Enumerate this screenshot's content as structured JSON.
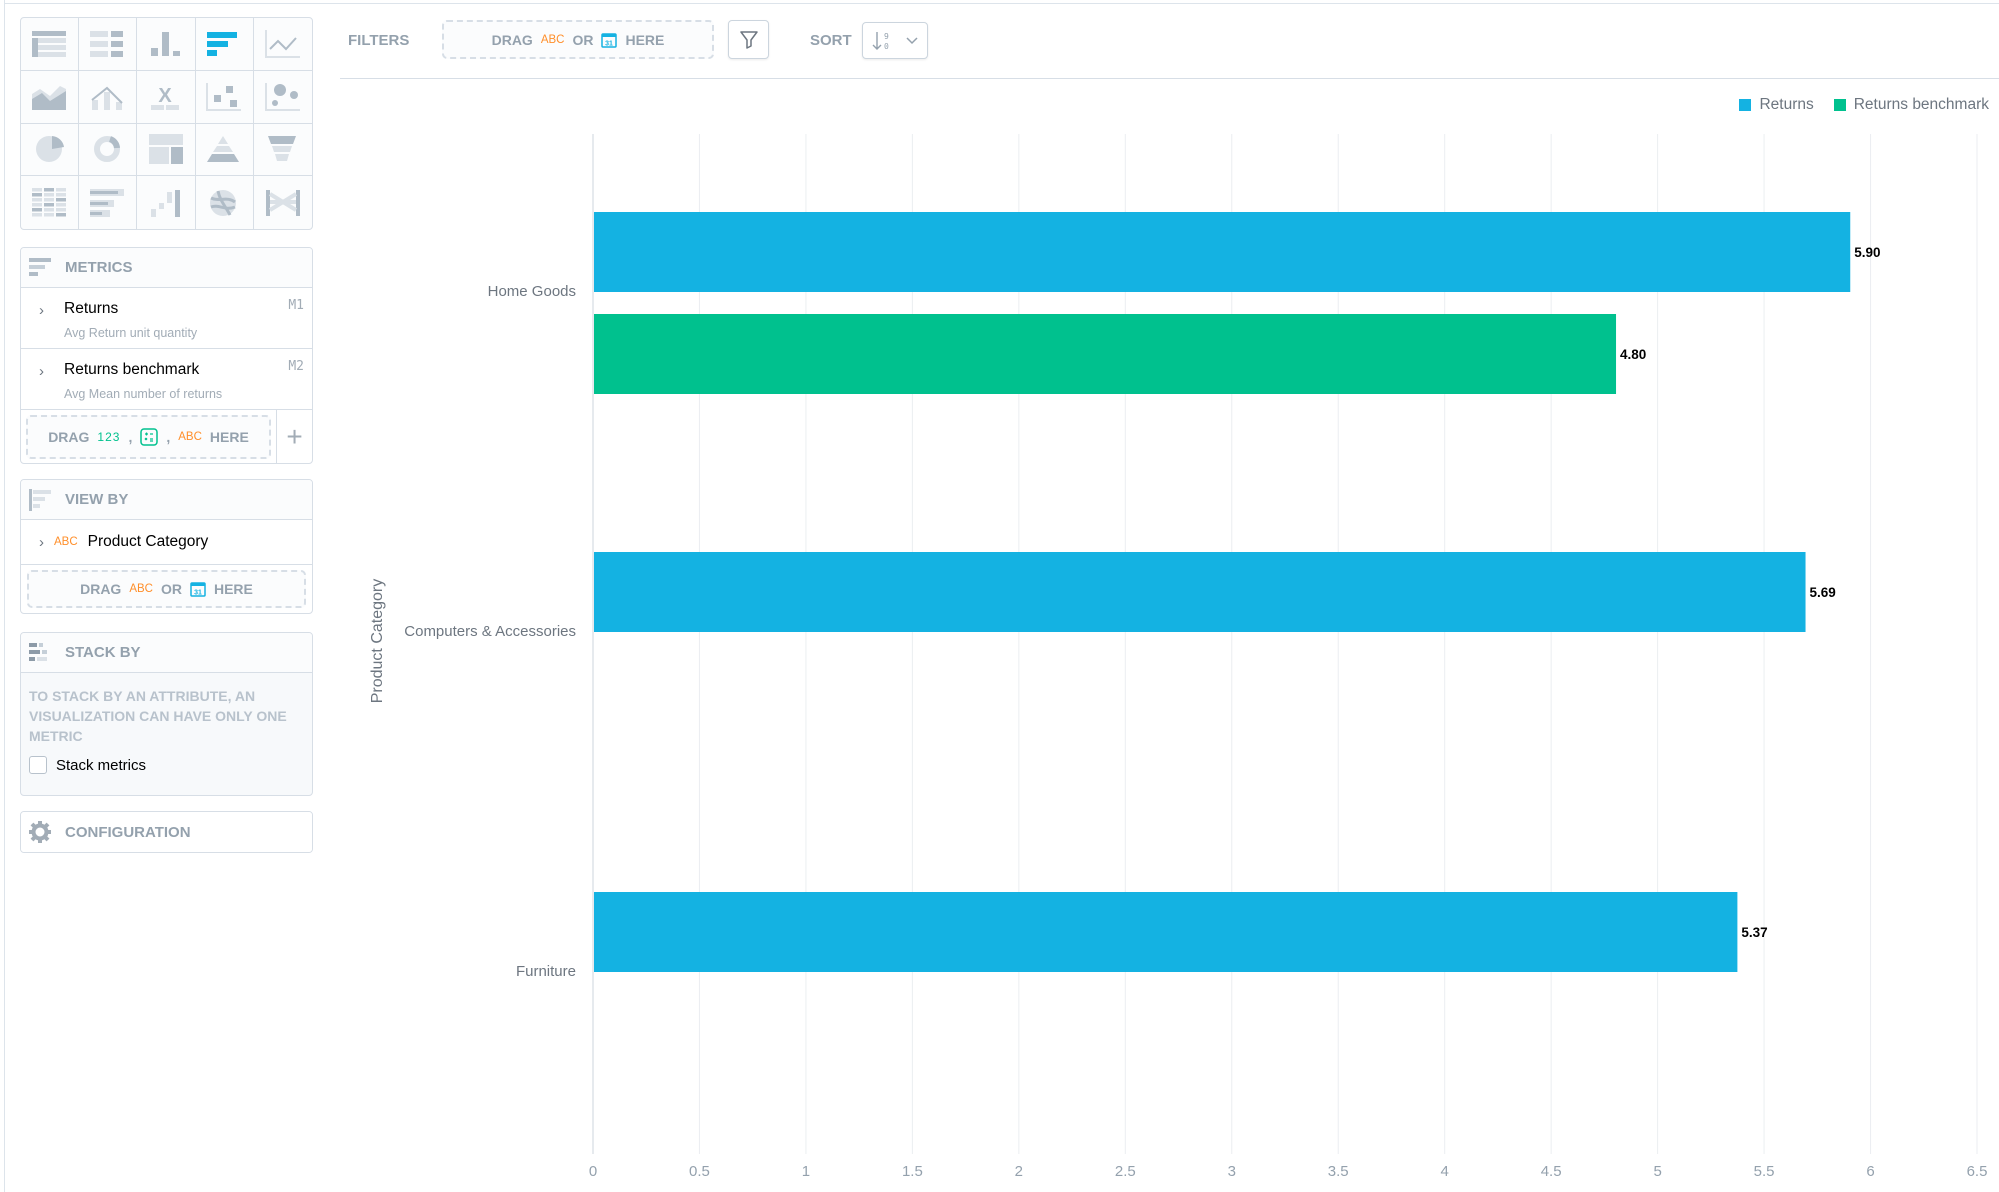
{
  "viz_types": [
    "table",
    "headline",
    "column-chart",
    "bar-chart",
    "line-chart",
    "area-chart",
    "combo-chart",
    "xirr",
    "scatter-plot",
    "bubble-chart",
    "pie-chart",
    "donut-chart",
    "treemap",
    "pyramid-chart",
    "funnel-chart",
    "heatmap",
    "bullet-chart",
    "waterfall-chart",
    "dependency-wheel",
    "sankey-chart"
  ],
  "active_viz": "bar-chart",
  "header": {
    "filters_label": "FILTERS",
    "filters_drop": {
      "drag": "DRAG",
      "abc": "ABC",
      "or": "OR",
      "here": "HERE"
    },
    "sort_label": "SORT"
  },
  "metrics": {
    "title": "METRICS",
    "items": [
      {
        "name": "Returns",
        "sub": "Avg Return unit quantity",
        "id": "M1"
      },
      {
        "name": "Returns benchmark",
        "sub": "Avg Mean number of returns",
        "id": "M2"
      }
    ],
    "drop": {
      "drag": "DRAG",
      "num": "123",
      "comma": ",",
      "abc": "ABC",
      "here": "HERE"
    }
  },
  "view_by": {
    "title": "VIEW BY",
    "item": {
      "abc": "ABC",
      "name": "Product Category"
    },
    "drop": {
      "drag": "DRAG",
      "abc": "ABC",
      "or": "OR",
      "here": "HERE"
    }
  },
  "stack_by": {
    "title": "STACK BY",
    "notice": "TO STACK BY AN ATTRIBUTE, AN VISUALIZATION CAN HAVE ONLY ONE METRIC",
    "checkbox_label": "Stack metrics",
    "checked": false
  },
  "configuration": {
    "title": "CONFIGURATION"
  },
  "colors": {
    "returns": "#14b2e2",
    "benchmark": "#00c18e"
  },
  "chart_data": {
    "type": "bar",
    "orientation": "horizontal",
    "categories": [
      "Home Goods",
      "Computers & Accessories",
      "Furniture"
    ],
    "series": [
      {
        "name": "Returns",
        "values": [
          5.9,
          5.69,
          5.37
        ]
      },
      {
        "name": "Returns benchmark",
        "values": [
          4.8,
          null,
          null
        ]
      }
    ],
    "data_labels": [
      [
        "5.90",
        "5.69",
        "5.37"
      ],
      [
        "4.80",
        null,
        null
      ]
    ],
    "ylabel": "Product Category",
    "xlabel": "",
    "xlim": [
      0,
      6.5
    ],
    "xticks": [
      "0",
      "0.5",
      "1",
      "1.5",
      "2",
      "2.5",
      "3",
      "3.5",
      "4",
      "4.5",
      "5",
      "5.5",
      "6",
      "6.5"
    ],
    "grid": true,
    "legend": "top-right"
  }
}
